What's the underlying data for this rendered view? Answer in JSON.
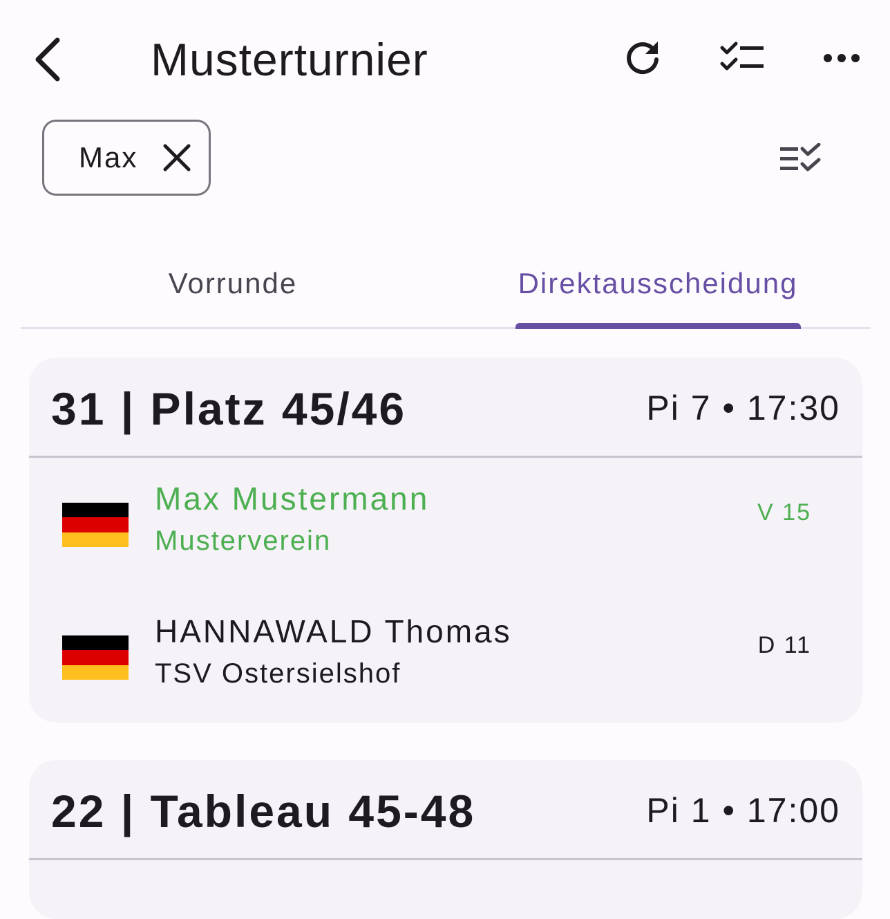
{
  "app_bar": {
    "title": "Musterturnier"
  },
  "filter": {
    "chip_label": "Max"
  },
  "tabs": [
    {
      "label": "Vorrunde",
      "selected": false
    },
    {
      "label": "Direktausscheidung",
      "selected": true
    }
  ],
  "colors": {
    "accent": "#6750a4",
    "winner": "#4caf50",
    "card_background": "#f5f2f8"
  },
  "matches": [
    {
      "title": "31 | Platz 45/46",
      "meta": "Pi 7 • 17:30",
      "fencers": [
        {
          "name": "Max Mustermann",
          "club": "Musterverein",
          "result": "V 15",
          "flag": "germany-flag",
          "winner": true
        },
        {
          "name": "HANNAWALD Thomas",
          "club": "TSV Ostersielshof",
          "result": "D 11",
          "flag": "germany-flag",
          "winner": false
        }
      ]
    },
    {
      "title": "22 | Tableau 45-48",
      "meta": "Pi 1 • 17:00"
    }
  ]
}
